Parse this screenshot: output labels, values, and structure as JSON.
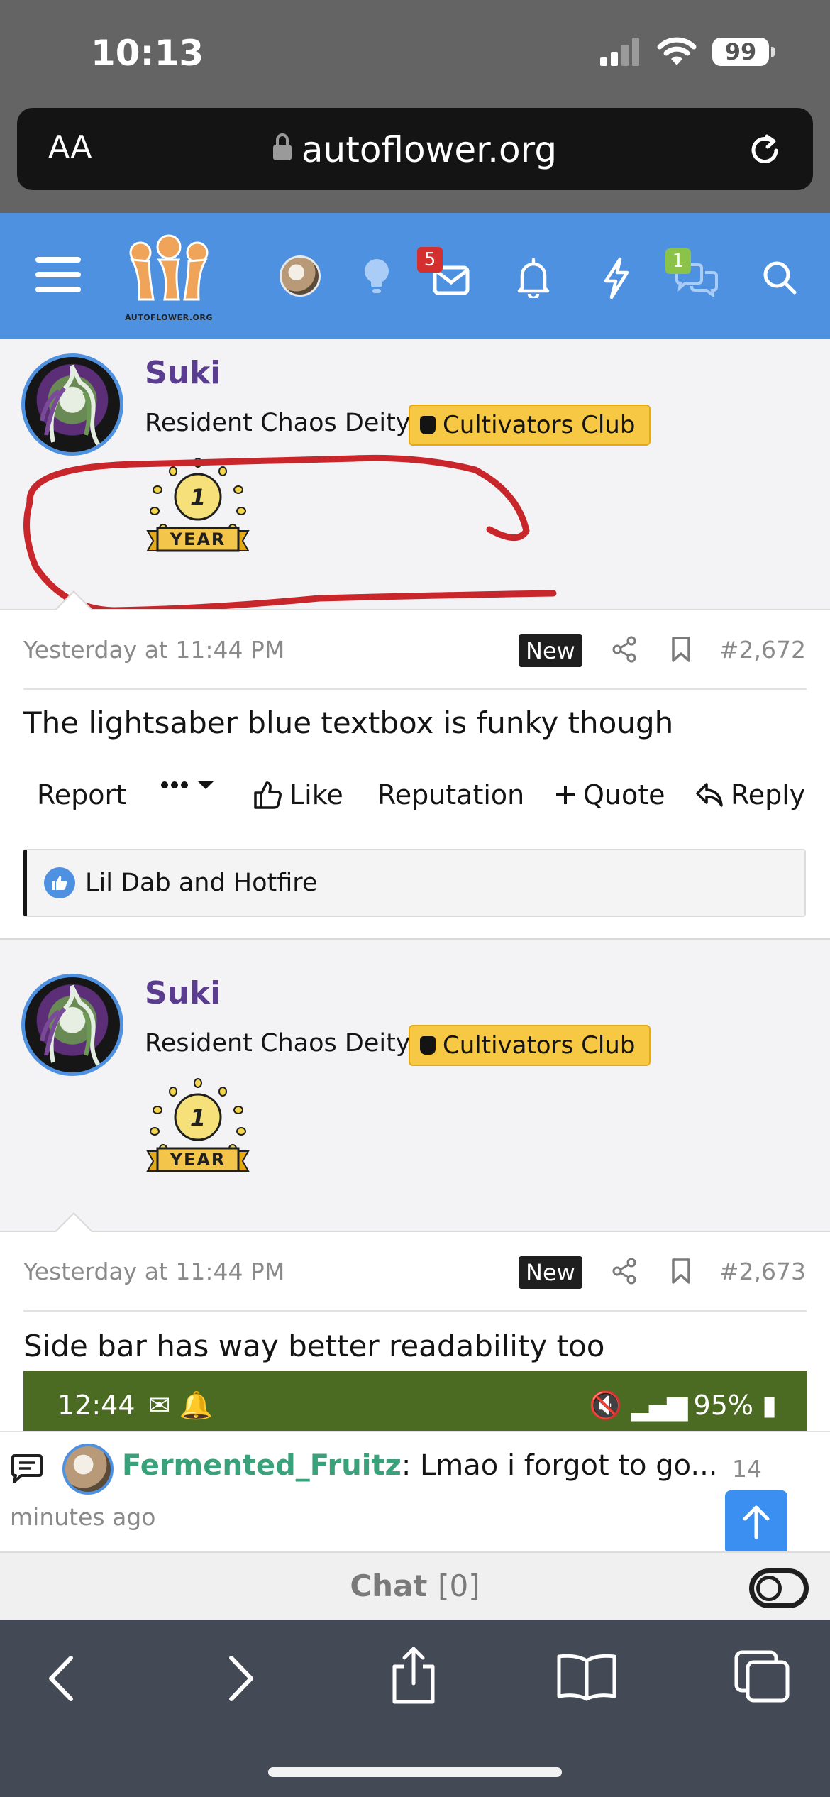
{
  "status_bar": {
    "time": "10:13",
    "battery": "99"
  },
  "browser": {
    "aa_label": "AA",
    "url": "autoflower.org"
  },
  "site_header": {
    "logo_text": "AUTOFLOWER.ORG",
    "inbox_badge": "5",
    "conversations_badge": "1",
    "accent_color": "#4f91e1"
  },
  "posts": [
    {
      "username": "Suki",
      "user_title": "Resident Chaos Deity",
      "club": "Cultivators Club",
      "year_badge": {
        "number": "1",
        "label": "YEAR"
      },
      "timestamp": "Yesterday at 11:44 PM",
      "new_label": "New",
      "post_number": "#2,672",
      "body": "The lightsaber blue textbox is funky though",
      "actions": {
        "report": "Report",
        "like": "Like",
        "reputation": "Reputation",
        "quote": "Quote",
        "reply": "Reply"
      },
      "reactions": "Lil Dab and Hotfire"
    },
    {
      "username": "Suki",
      "user_title": "Resident Chaos Deity",
      "club": "Cultivators Club",
      "year_badge": {
        "number": "1",
        "label": "YEAR"
      },
      "timestamp": "Yesterday at 11:44 PM",
      "new_label": "New",
      "post_number": "#2,673",
      "body": "Side bar has way better readability too",
      "embedded_status": {
        "time": "12:44",
        "battery": "95%"
      }
    }
  ],
  "chat_preview": {
    "user": "Fermented_Fruitz",
    "message": ": Lmao i forgot to go...",
    "time_part1": "14",
    "time_part2": "minutes ago"
  },
  "chat_bar": {
    "label": "Chat",
    "count": "[0]"
  },
  "annotation_color": "#c8262b"
}
